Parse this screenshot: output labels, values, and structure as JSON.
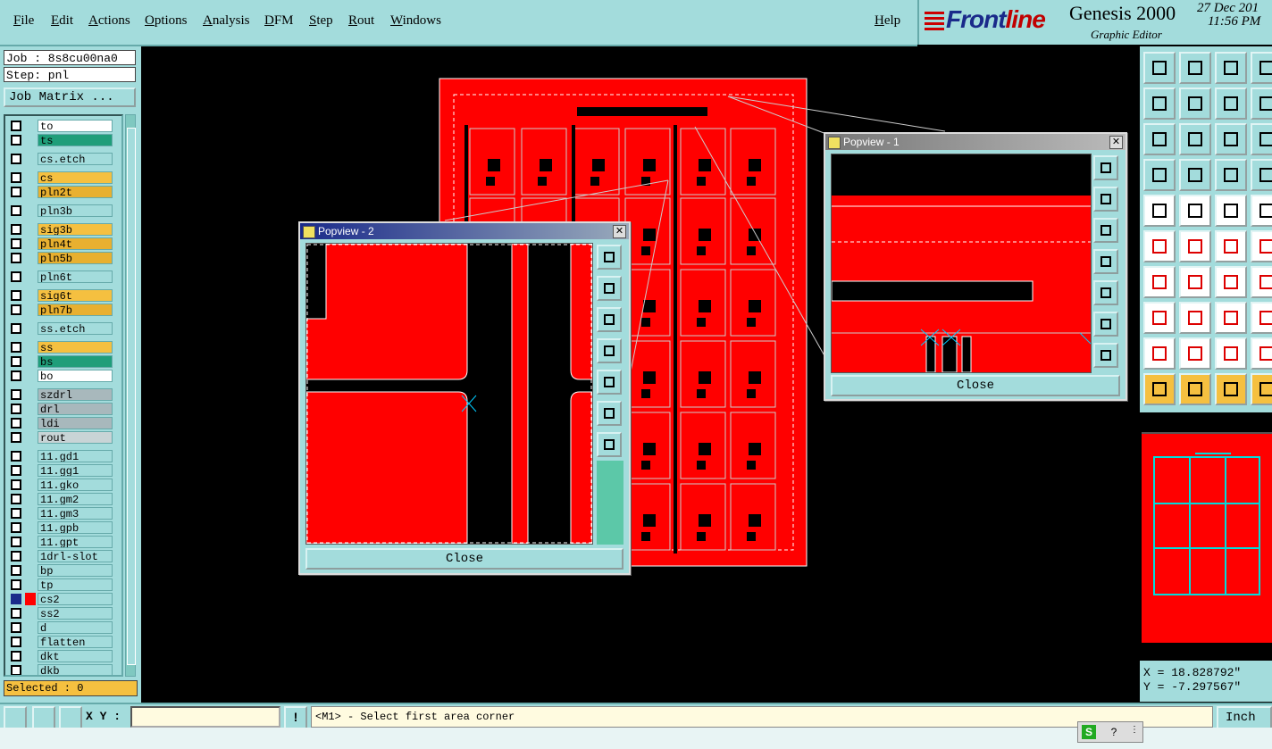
{
  "menubar": {
    "items": [
      "File",
      "Edit",
      "Actions",
      "Options",
      "Analysis",
      "DFM",
      "Step",
      "Rout",
      "Windows"
    ],
    "help": "Help"
  },
  "brand": {
    "logo_part1": "Front",
    "logo_part2": "line",
    "product": "Genesis 2000",
    "subtitle": "Graphic Editor",
    "date": "27 Dec 201",
    "time": "11:56 PM"
  },
  "left_panel": {
    "job_line": "Job : 8s8cu00na0",
    "step_line": "Step: pnl",
    "job_matrix_button": "Job Matrix ...",
    "selected_status": "Selected : 0"
  },
  "layers": [
    {
      "name": "to",
      "color": "#ffffff"
    },
    {
      "name": "ts",
      "color": "#1f9e7a"
    },
    {
      "name": "cs.etch",
      "color": "#a3dcdc"
    },
    {
      "name": "cs",
      "color": "#f5c040"
    },
    {
      "name": "pln2t",
      "color": "#e8b030"
    },
    {
      "name": "pln3b",
      "color": "#a3dcdc"
    },
    {
      "name": "sig3b",
      "color": "#f5c040"
    },
    {
      "name": "pln4t",
      "color": "#e8b030"
    },
    {
      "name": "pln5b",
      "color": "#e8b030"
    },
    {
      "name": "pln6t",
      "color": "#a3dcdc"
    },
    {
      "name": "sig6t",
      "color": "#f5c040"
    },
    {
      "name": "pln7b",
      "color": "#e8b030"
    },
    {
      "name": "ss.etch",
      "color": "#a3dcdc"
    },
    {
      "name": "ss",
      "color": "#f5c040"
    },
    {
      "name": "bs",
      "color": "#1f9e7a"
    },
    {
      "name": "bo",
      "color": "#ffffff"
    },
    {
      "name": "szdrl",
      "color": "#a8b8bc"
    },
    {
      "name": "drl",
      "color": "#a8b8bc"
    },
    {
      "name": "ldi",
      "color": "#a8b8bc"
    },
    {
      "name": "rout",
      "color": "#c8d4d6"
    },
    {
      "name": "11.gd1",
      "color": "#a3dcdc"
    },
    {
      "name": "11.gg1",
      "color": "#a3dcdc"
    },
    {
      "name": "11.gko",
      "color": "#a3dcdc"
    },
    {
      "name": "11.gm2",
      "color": "#a3dcdc"
    },
    {
      "name": "11.gm3",
      "color": "#a3dcdc"
    },
    {
      "name": "11.gpb",
      "color": "#a3dcdc"
    },
    {
      "name": "11.gpt",
      "color": "#a3dcdc"
    },
    {
      "name": "1drl-slot",
      "color": "#a3dcdc"
    },
    {
      "name": "bp",
      "color": "#a3dcdc"
    },
    {
      "name": "tp",
      "color": "#a3dcdc"
    },
    {
      "name": "cs2",
      "color": "#a3dcdc"
    },
    {
      "name": "ss2",
      "color": "#a3dcdc"
    },
    {
      "name": "d",
      "color": "#a3dcdc"
    },
    {
      "name": "flatten",
      "color": "#a3dcdc"
    },
    {
      "name": "dkt",
      "color": "#a3dcdc"
    },
    {
      "name": "dkb",
      "color": "#a3dcdc"
    }
  ],
  "popup1": {
    "title": "Popview - 1",
    "close_label": "Close"
  },
  "popup2": {
    "title": "Popview - 2",
    "close_label": "Close"
  },
  "coords": {
    "x": "X = 18.828792\"",
    "y": "Y = -7.297567\""
  },
  "bottom": {
    "xy_label": "X Y :",
    "xy_value": "",
    "prompt": "<M1> - Select first area corner",
    "units": "Inch",
    "exclaim": "!"
  },
  "colors": {
    "accent": "#a3dcdc",
    "board": "#ff0000",
    "highlight": "#f5c040",
    "active": "#1f9e7a"
  }
}
